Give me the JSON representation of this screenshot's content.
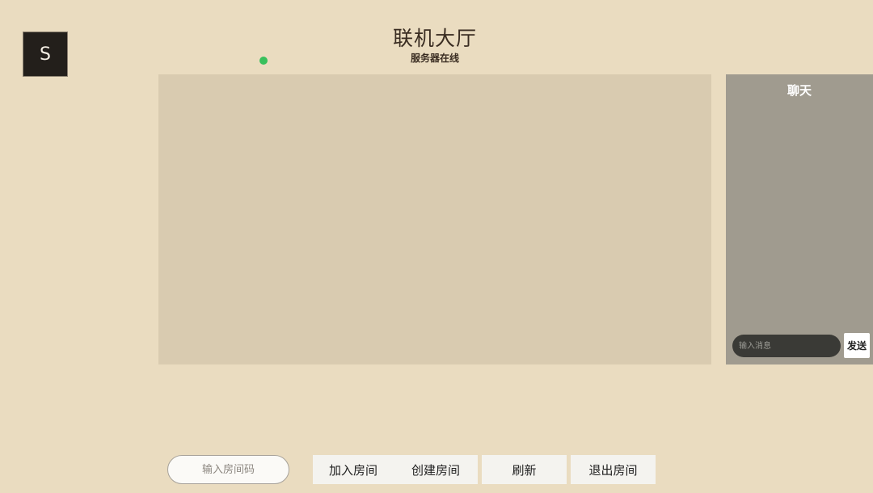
{
  "user": {
    "avatar_initial": "S"
  },
  "header": {
    "title": "联机大厅",
    "server_status": "服务器在线",
    "status_color": "#38C05C"
  },
  "chat": {
    "title": "聊天",
    "input_placeholder": "输入消息",
    "send_label": "发送"
  },
  "controls": {
    "room_code_placeholder": "输入房间码",
    "join_label": "加入房间",
    "create_label": "创建房间",
    "refresh_label": "刷新",
    "leave_label": "退出房间"
  },
  "colors": {
    "background": "#EADCC0",
    "room_list_bg": "#D9CBB0",
    "chat_panel_bg": "#A09B8F"
  }
}
